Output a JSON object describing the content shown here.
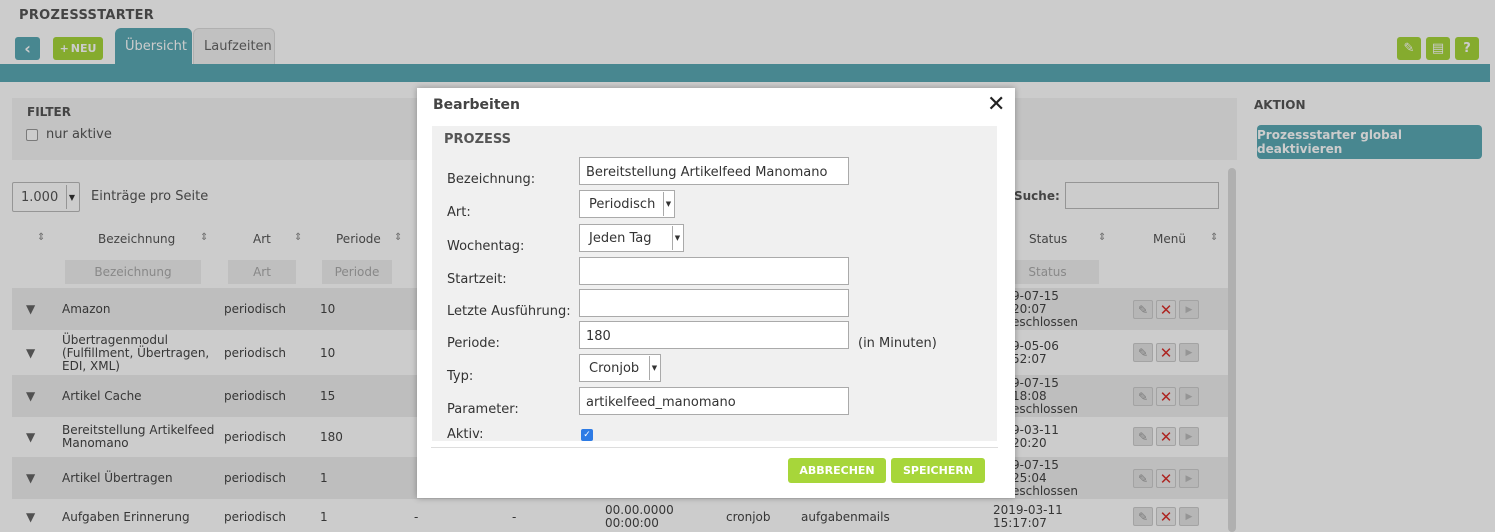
{
  "app": {
    "title": "PROZESSSTARTER"
  },
  "toolbar": {
    "back_icon": "chevron-left-icon",
    "new_label": "NEU",
    "new_icon": "plus-icon"
  },
  "tabs": [
    {
      "label": "Übersicht",
      "active": true
    },
    {
      "label": "Laufzeiten",
      "active": false
    }
  ],
  "tools": {
    "edit_icon": "pencil-icon",
    "print_icon": "printer-icon",
    "help_label": "?"
  },
  "filter": {
    "title": "FILTER",
    "only_active_label": "nur aktive"
  },
  "aktion": {
    "title": "AKTION",
    "button_label": "Prozessstarter global deaktivieren"
  },
  "list": {
    "per_page_value": "1.000",
    "per_page_label": "Einträge pro Seite",
    "search_label": "Suche:",
    "columns": {
      "bezeichnung": "Bezeichnung",
      "art": "Art",
      "periode": "Periode",
      "status": "Status",
      "menu": "Menü"
    },
    "column_filters": {
      "bezeichnung": "Bezeichnung",
      "art": "Art",
      "periode": "Periode",
      "status": "Status"
    },
    "rows": [
      {
        "name": "Amazon",
        "art": "periodisch",
        "periode": "10",
        "c5": "",
        "c6": "",
        "c7": "",
        "c8": "",
        "c9": "",
        "status": "9-07-15\n20:07\neschlossen"
      },
      {
        "name": "Übertragenmodul\n(Fulfillment, Übertragen,\nEDI, XML)",
        "art": "periodisch",
        "periode": "10",
        "c5": "",
        "c6": "",
        "c7": "",
        "c8": "",
        "c9": "",
        "status": "9-05-06\n52:07"
      },
      {
        "name": "Artikel Cache",
        "art": "periodisch",
        "periode": "15",
        "c5": "",
        "c6": "",
        "c7": "",
        "c8": "",
        "c9": "",
        "status": "9-07-15\n18:08\neschlossen"
      },
      {
        "name": "Bereitstellung Artikelfeed\nManomano",
        "art": "periodisch",
        "periode": "180",
        "c5": "",
        "c6": "",
        "c7": "",
        "c8": "",
        "c9": "",
        "status": "9-03-11\n20:20"
      },
      {
        "name": "Artikel Übertragen",
        "art": "periodisch",
        "periode": "1",
        "c5": "",
        "c6": "",
        "c7": "",
        "c8": "",
        "c9": "",
        "status": "9-07-15\n25:04\neschlossen"
      },
      {
        "name": "Aufgaben Erinnerung",
        "art": "periodisch",
        "periode": "1",
        "c5": "-",
        "c6": "-",
        "c7": "00.00.0000\n00:00:00",
        "c8": "cronjob",
        "c9": "aufgabenmails",
        "status": "2019-03-11\n15:17:07"
      }
    ]
  },
  "modal": {
    "title": "Bearbeiten",
    "close_icon": "close-icon",
    "section_title": "PROZESS",
    "fields": {
      "bezeichnung": {
        "label": "Bezeichnung:",
        "value": "Bereitstellung Artikelfeed Manomano"
      },
      "art": {
        "label": "Art:",
        "value": "Periodisch"
      },
      "wochentag": {
        "label": "Wochentag:",
        "value": "Jeden Tag"
      },
      "startzeit": {
        "label": "Startzeit:",
        "value": ""
      },
      "letzte": {
        "label": "Letzte Ausführung:",
        "value": ""
      },
      "periode": {
        "label": "Periode:",
        "value": "180",
        "hint": "(in Minuten)"
      },
      "typ": {
        "label": "Typ:",
        "value": "Cronjob"
      },
      "parameter": {
        "label": "Parameter:",
        "value": "artikelfeed_manomano"
      },
      "aktiv": {
        "label": "Aktiv:",
        "checked": true
      }
    },
    "cancel_label": "ABBRECHEN",
    "save_label": "SPEICHERN"
  },
  "colors": {
    "teal": "#5aa9b5",
    "green": "#a7d63a",
    "danger": "#d9302b"
  }
}
